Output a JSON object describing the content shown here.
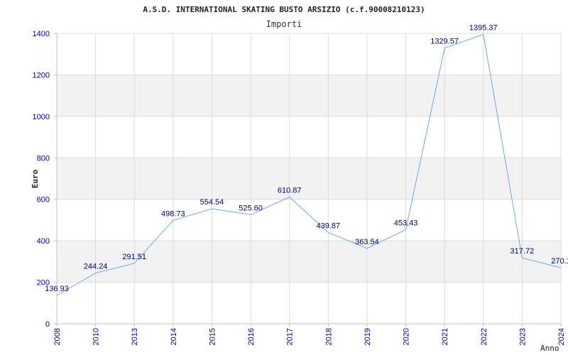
{
  "chart_data": {
    "type": "line",
    "title": "A.S.D. INTERNATIONAL SKATING BUSTO ARSIZIO (c.f.90008210123)",
    "subtitle": "Importi",
    "xlabel": "Anno",
    "ylabel": "Euro",
    "x": [
      "2008",
      "2010",
      "2013",
      "2014",
      "2015",
      "2016",
      "2017",
      "2018",
      "2019",
      "2020",
      "2021",
      "2022",
      "2023",
      "2024"
    ],
    "values": [
      136.93,
      244.24,
      291.51,
      498.73,
      554.54,
      525.6,
      610.87,
      439.87,
      363.54,
      453.43,
      1329.57,
      1395.37,
      317.72,
      270.1
    ],
    "value_labels": [
      "136.93",
      "244.24",
      "291.51",
      "498.73",
      "554.54",
      "525.60",
      "610.87",
      "439.87",
      "363.54",
      "453.43",
      "1329.57",
      "1395.37",
      "317.72",
      "270.1"
    ],
    "ylim": [
      0,
      1400
    ],
    "yticks": [
      0,
      200,
      400,
      600,
      800,
      1000,
      1200,
      1400
    ],
    "grid": true,
    "line_color": "#6aa9e8",
    "tick_color": "#0000aa",
    "band_color": "#f2f2f2"
  }
}
